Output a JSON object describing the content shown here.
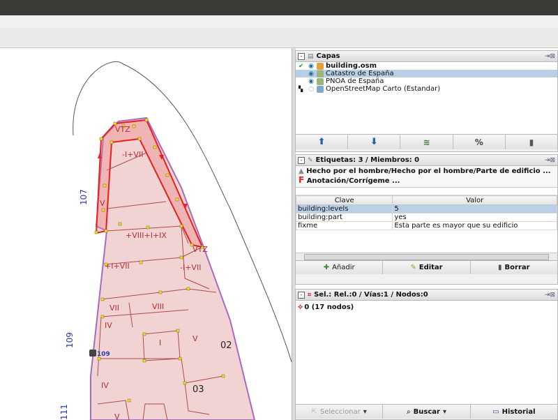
{
  "layers_panel": {
    "title": "Capas",
    "layers": [
      {
        "name": "building.osm",
        "bold": true,
        "visible": true,
        "active": true,
        "selected": false
      },
      {
        "name": "Catastro de España",
        "bold": false,
        "visible": true,
        "active": false,
        "selected": true
      },
      {
        "name": "PNOA de España",
        "bold": false,
        "visible": true,
        "active": false,
        "selected": false
      },
      {
        "name": "OpenStreetMap Carto (Estandar)",
        "bold": false,
        "visible": false,
        "active": false,
        "selected": false
      }
    ]
  },
  "tags_panel": {
    "title": "Etiquetas: 3 / Miembros: 0",
    "summary_line1": "Hecho por el hombre/Hecho por el hombre/Parte de edificio ...",
    "summary_line2": "Anotación/Corrígeme ...",
    "col_key": "Clave",
    "col_value": "Valor",
    "rows": [
      {
        "key": "building:levels",
        "value": "5",
        "selected": true
      },
      {
        "key": "building:part",
        "value": "yes",
        "selected": false
      },
      {
        "key": "fixme",
        "value": "Esta parte es mayor que su edificio",
        "selected": false
      }
    ],
    "buttons": {
      "add": "Añadir",
      "edit": "Editar",
      "delete": "Borrar"
    }
  },
  "selection_panel": {
    "title": "Sel.: Rel.:0 / Vías:1 / Nodos:0",
    "item": "0 (17 nodos)",
    "buttons": {
      "select": "Seleccionar",
      "search": "Buscar",
      "history": "Historial"
    }
  },
  "map": {
    "labels": {
      "street_107": "107",
      "street_109": "109",
      "street_111": "111",
      "house_109": "109",
      "b1": "VTZ",
      "b2": "-I+VII",
      "b3": "V",
      "b4": "+VIII+I+IX",
      "b5": "VTZ",
      "b6": "+I+VII",
      "b7": "-I+VII",
      "b8": "VII",
      "b9": "VIII",
      "b10": "IV",
      "b11": "I",
      "b12": "V",
      "b13": "02",
      "b14": "IV",
      "b15": "03",
      "b16": "V"
    }
  },
  "colors": {
    "selected_way": "#e8201e",
    "building_fill": "#f2d3d3",
    "building_outline": "#a86ac0",
    "node": "#f5e400"
  }
}
